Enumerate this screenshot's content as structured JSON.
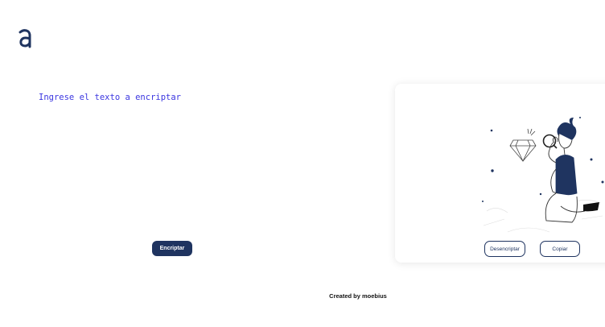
{
  "logo": {
    "icon": "logo-a-icon",
    "color": "#1f3460"
  },
  "input": {
    "placeholder": "Ingrese el texto a encriptar",
    "value": ""
  },
  "buttons": {
    "encrypt_label": "Encriptar",
    "decrypt_label": "Desencriptar",
    "copy_label": "Copiar"
  },
  "illustration": {
    "icon": "person-with-magnifier-illustration"
  },
  "footer": {
    "text": "Created by moebius"
  },
  "colors": {
    "primary": "#1f3460",
    "text_accent": "#3b36e0",
    "background": "#ffffff"
  }
}
